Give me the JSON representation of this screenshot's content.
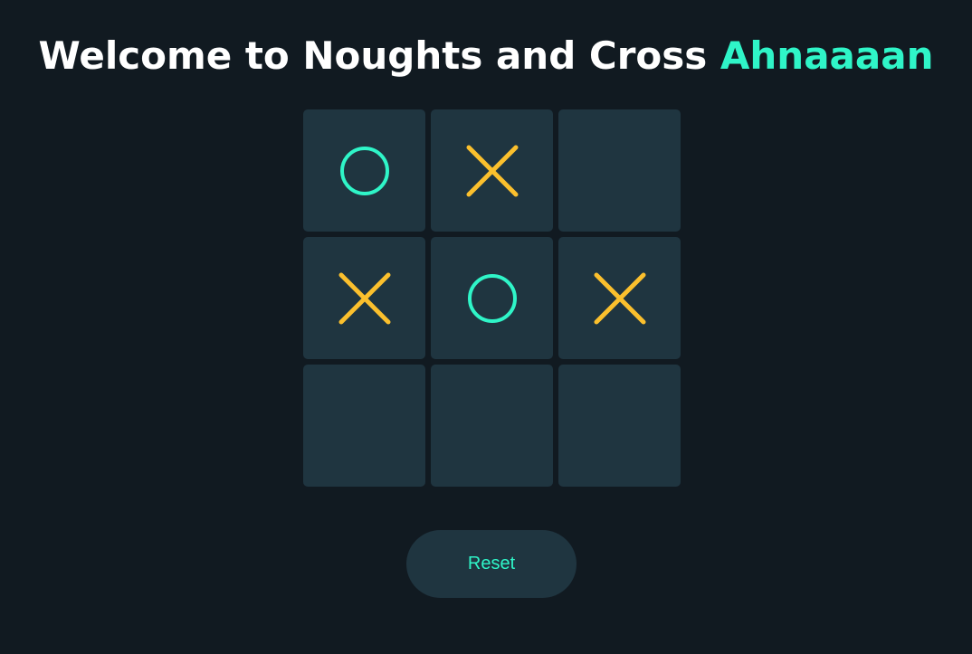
{
  "header": {
    "title_prefix": "Welcome to Noughts and Cross ",
    "player_name": "Ahnaaaan"
  },
  "board": {
    "cells": [
      "O",
      "X",
      "",
      "X",
      "O",
      "X",
      "",
      "",
      ""
    ]
  },
  "controls": {
    "reset_label": "Reset"
  },
  "colors": {
    "background": "#111a21",
    "cell": "#1f3540",
    "nought": "#2ff5c8",
    "cross": "#fbc02d",
    "title": "#ffffff",
    "accent": "#2ff5c8"
  }
}
